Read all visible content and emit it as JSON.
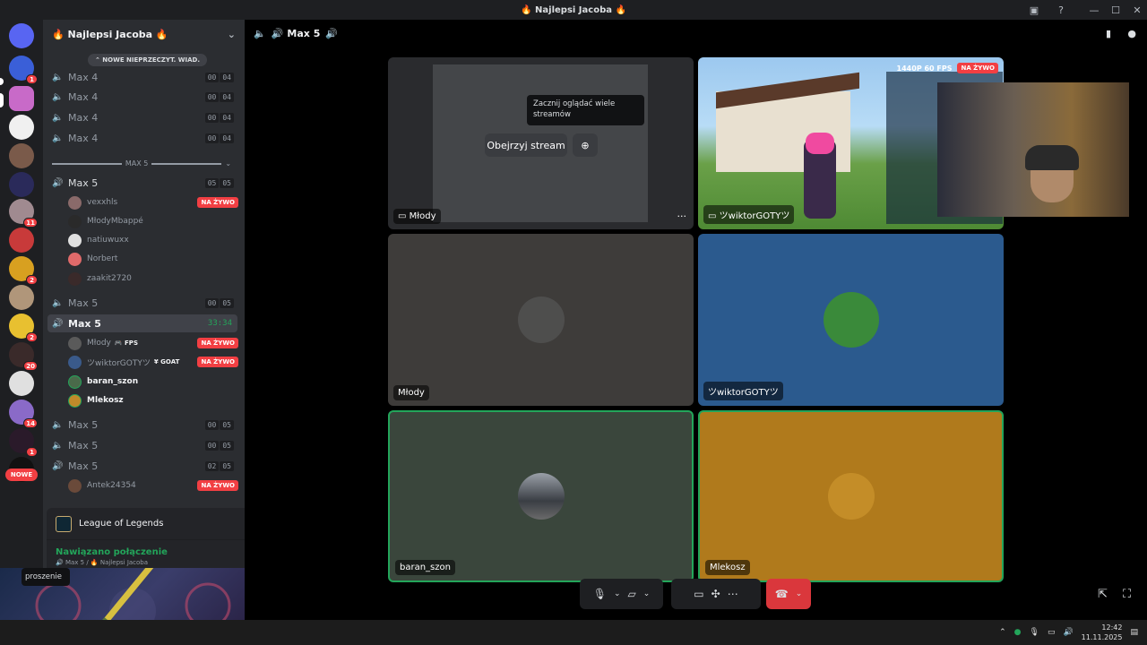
{
  "window": {
    "title": "🔥 Najlepsi Jacoba 🔥",
    "minimize": "—",
    "maximize": "☐",
    "close": "✕"
  },
  "server": {
    "name": "🔥 Najlepsi Jacoba 🔥",
    "new_unread": "⌃ NOWE NIEPRZECZYT. WIAD."
  },
  "guild_badges": [
    "1",
    "11",
    "2",
    "2",
    "20",
    "14",
    "1"
  ],
  "nowe_label": "NOWE",
  "category_label": "MAX 5",
  "channels_top": [
    {
      "name": "Max 4",
      "count": [
        "00",
        "04"
      ]
    },
    {
      "name": "Max 4",
      "count": [
        "00",
        "04"
      ]
    },
    {
      "name": "Max 4",
      "count": [
        "00",
        "04"
      ]
    },
    {
      "name": "Max 4",
      "count": [
        "00",
        "04"
      ]
    }
  ],
  "channel_max5_a": {
    "name": "Max 5",
    "count": [
      "05",
      "05"
    ]
  },
  "users_a": [
    {
      "name": "vexxhls",
      "live": "NA ŻYWO"
    },
    {
      "name": "MłodyMbappé",
      "live": ""
    },
    {
      "name": "natiuwuxx",
      "live": ""
    },
    {
      "name": "Norbert",
      "live": ""
    },
    {
      "name": "zaakit2720",
      "live": ""
    }
  ],
  "channel_max5_b": {
    "name": "Max 5",
    "count": [
      "00",
      "05"
    ]
  },
  "active_channel": {
    "name": "Max 5",
    "time": "33:34"
  },
  "users_active": [
    {
      "name": "Młody",
      "tag": "🎮 FPS",
      "live": "NA ŻYWO"
    },
    {
      "name": "ツwiktorGOTYツ",
      "tag": "¥ GOAT",
      "live": "NA ŻYWO"
    },
    {
      "name": "baran_szon",
      "tag": "",
      "live": ""
    },
    {
      "name": "Mlekosz",
      "tag": "",
      "live": ""
    }
  ],
  "channels_bottom": [
    {
      "name": "Max 5",
      "count": [
        "00",
        "05"
      ]
    },
    {
      "name": "Max 5",
      "count": [
        "00",
        "05"
      ]
    },
    {
      "name": "Max 5",
      "count": [
        "02",
        "05"
      ]
    }
  ],
  "partial_user": {
    "name": "Antek24354",
    "live": "NA ŻYWO"
  },
  "panel": {
    "game": "League of Legends",
    "status": "Nawiązano połączenie",
    "location": "🔊 Max 5 / 🔥 Najlepsi Jacoba"
  },
  "invite_label": "proszenie",
  "call": {
    "header": "Max 5",
    "tooltip": "Zacznij oglądać wiele streamów",
    "watch_button": "Obejrzyj stream",
    "more": "···",
    "stream_badge": "1440P 60 FPS",
    "live": "NA ŻYWO",
    "tiles": [
      {
        "label": "Młody",
        "kind": "stream"
      },
      {
        "label": "ツwiktorGOTYツ",
        "kind": "stream"
      },
      {
        "label": "Młody",
        "kind": "cam"
      },
      {
        "label": "ツwiktorGOTYツ",
        "kind": "cam"
      },
      {
        "label": "baran_szon",
        "kind": "cam"
      },
      {
        "label": "Mlekosz",
        "kind": "cam"
      }
    ]
  },
  "clock": {
    "time": "12:42",
    "date": "11.11.2025"
  },
  "colors": {
    "green": "#23a55a",
    "red": "#f23f43",
    "blue_tile": "#2b5a8e",
    "orange_tile": "#b07a1c",
    "grey_tile": "#3e3c3a",
    "green_tile": "#3a463c"
  }
}
